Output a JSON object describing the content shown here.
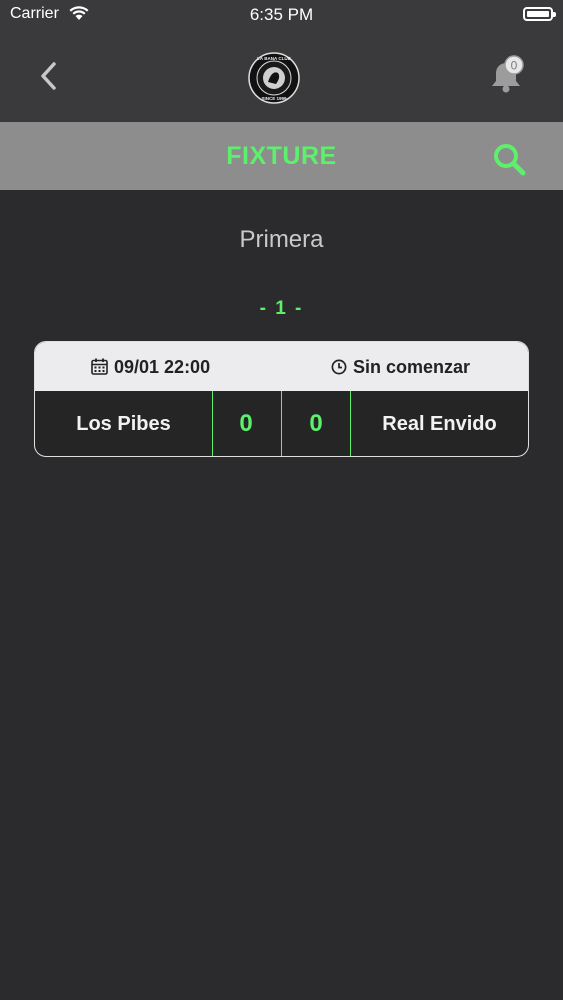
{
  "status_bar": {
    "carrier": "Carrier",
    "time": "6:35 PM"
  },
  "navbar": {
    "notification_count": "0",
    "logo_text": "LA BANA CLUB · SINCE 1999"
  },
  "header": {
    "title": "FIXTURE"
  },
  "division": "Primera",
  "round": "- 1 -",
  "match": {
    "date": "09/01 22:00",
    "status": "Sin comenzar",
    "home_team": "Los Pibes",
    "home_score": "0",
    "away_score": "0",
    "away_team": "Real Envido"
  },
  "colors": {
    "accent": "#5cf06b",
    "background": "#2b2b2d",
    "navbar": "#3a3a3c",
    "titlebar": "#8d8d8e"
  },
  "icons": [
    "wifi-icon",
    "battery-icon",
    "back-chevron-icon",
    "bell-icon",
    "search-icon",
    "calendar-icon",
    "clock-icon"
  ]
}
